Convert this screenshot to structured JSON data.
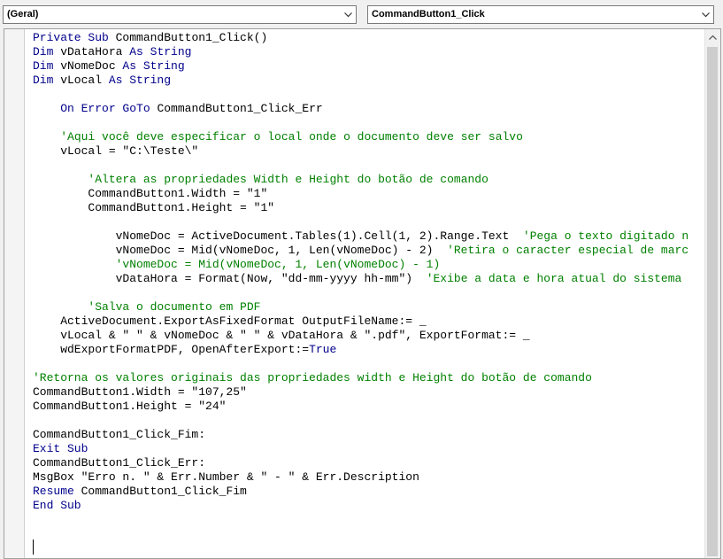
{
  "object_combo": {
    "value": "(Geral)",
    "icon": "chevron-down-icon"
  },
  "procedure_combo": {
    "value": "CommandButton1_Click",
    "icon": "chevron-down-icon"
  },
  "scrollbar": {
    "up_icon": "scroll-up-arrow-icon",
    "down_icon": "scroll-down-arrow-icon"
  },
  "code_colors": {
    "keyword": "#00008b",
    "comment": "#008000",
    "text": "#000000"
  },
  "code_lines": [
    [
      {
        "t": "kw",
        "v": "Private Sub"
      },
      {
        "t": "tx",
        "v": " CommandButton1_Click()"
      }
    ],
    [
      {
        "t": "kw",
        "v": "Dim"
      },
      {
        "t": "tx",
        "v": " vDataHora "
      },
      {
        "t": "kw",
        "v": "As String"
      }
    ],
    [
      {
        "t": "kw",
        "v": "Dim"
      },
      {
        "t": "tx",
        "v": " vNomeDoc "
      },
      {
        "t": "kw",
        "v": "As String"
      }
    ],
    [
      {
        "t": "kw",
        "v": "Dim"
      },
      {
        "t": "tx",
        "v": " vLocal "
      },
      {
        "t": "kw",
        "v": "As String"
      }
    ],
    [],
    [
      {
        "t": "tx",
        "v": "    "
      },
      {
        "t": "kw",
        "v": "On Error GoTo"
      },
      {
        "t": "tx",
        "v": " CommandButton1_Click_Err"
      }
    ],
    [],
    [
      {
        "t": "tx",
        "v": "    "
      },
      {
        "t": "cm",
        "v": "'Aqui você deve especificar o local onde o documento deve ser salvo"
      }
    ],
    [
      {
        "t": "tx",
        "v": "    vLocal = \"C:\\Teste\\\""
      }
    ],
    [],
    [
      {
        "t": "tx",
        "v": "        "
      },
      {
        "t": "cm",
        "v": "'Altera as propriedades Width e Height do botão de comando"
      }
    ],
    [
      {
        "t": "tx",
        "v": "        CommandButton1.Width = \"1\""
      }
    ],
    [
      {
        "t": "tx",
        "v": "        CommandButton1.Height = \"1\""
      }
    ],
    [],
    [
      {
        "t": "tx",
        "v": "            vNomeDoc = ActiveDocument.Tables(1).Cell(1, 2).Range.Text  "
      },
      {
        "t": "cm",
        "v": "'Pega o texto digitado n"
      }
    ],
    [
      {
        "t": "tx",
        "v": "            vNomeDoc = Mid(vNomeDoc, 1, Len(vNomeDoc) - 2)  "
      },
      {
        "t": "cm",
        "v": "'Retira o caracter especial de marc"
      }
    ],
    [
      {
        "t": "tx",
        "v": "            "
      },
      {
        "t": "cm",
        "v": "'vNomeDoc = Mid(vNomeDoc, 1, Len(vNomeDoc) - 1)"
      }
    ],
    [
      {
        "t": "tx",
        "v": "            vDataHora = Format(Now, \"dd-mm-yyyy hh-mm\")  "
      },
      {
        "t": "cm",
        "v": "'Exibe a data e hora atual do sistema"
      }
    ],
    [],
    [
      {
        "t": "tx",
        "v": "        "
      },
      {
        "t": "cm",
        "v": "'Salva o documento em PDF"
      }
    ],
    [
      {
        "t": "tx",
        "v": "    ActiveDocument.ExportAsFixedFormat OutputFileName:= _"
      }
    ],
    [
      {
        "t": "tx",
        "v": "    vLocal & \" \" & vNomeDoc & \" \" & vDataHora & \".pdf\", ExportFormat:= _"
      }
    ],
    [
      {
        "t": "tx",
        "v": "    wdExportFormatPDF, OpenAfterExport:="
      },
      {
        "t": "kw",
        "v": "True"
      }
    ],
    [],
    [
      {
        "t": "cm",
        "v": "'Retorna os valores originais das propriedades width e Height do botão de comando"
      }
    ],
    [
      {
        "t": "tx",
        "v": "CommandButton1.Width = \"107,25\""
      }
    ],
    [
      {
        "t": "tx",
        "v": "CommandButton1.Height = \"24\""
      }
    ],
    [],
    [
      {
        "t": "tx",
        "v": "CommandButton1_Click_Fim:"
      }
    ],
    [
      {
        "t": "kw",
        "v": "Exit Sub"
      }
    ],
    [
      {
        "t": "tx",
        "v": "CommandButton1_Click_Err:"
      }
    ],
    [
      {
        "t": "tx",
        "v": "MsgBox \"Erro n. \" & Err.Number & \" - \" & Err.Description"
      }
    ],
    [
      {
        "t": "kw",
        "v": "Resume"
      },
      {
        "t": "tx",
        "v": " CommandButton1_Click_Fim"
      }
    ],
    [
      {
        "t": "kw",
        "v": "End Sub"
      }
    ]
  ]
}
